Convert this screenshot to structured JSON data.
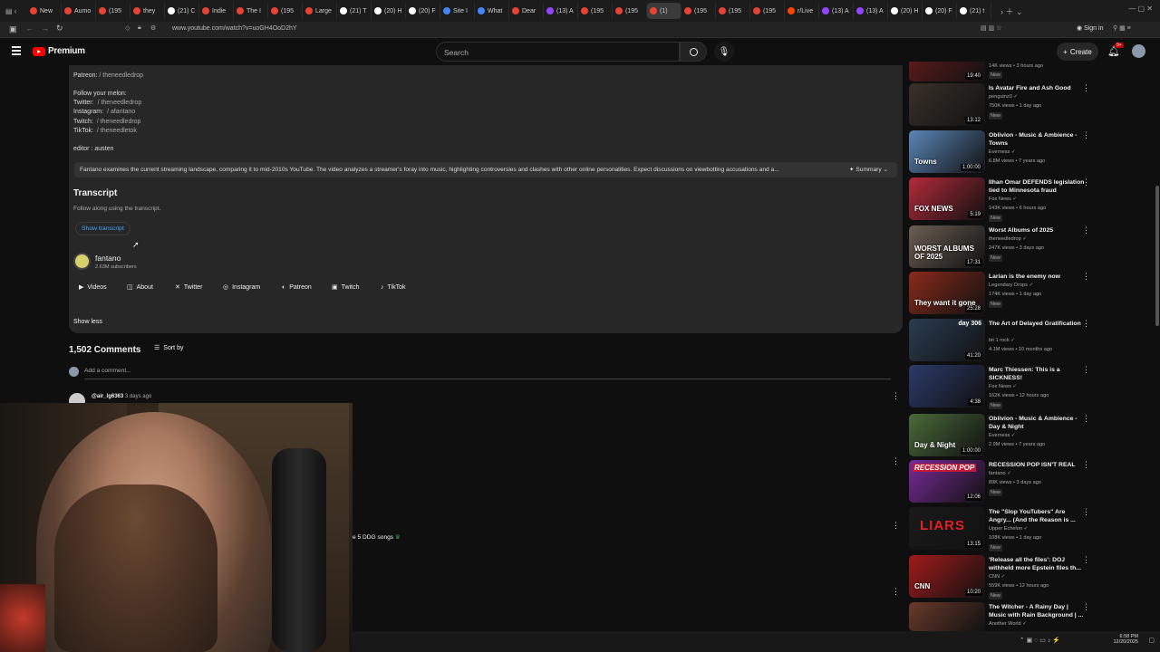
{
  "browser": {
    "tabs": [
      {
        "label": "New",
        "color": "#e94235"
      },
      {
        "label": "Aumo",
        "color": "#e94235"
      },
      {
        "label": "(195",
        "color": "#e94235"
      },
      {
        "label": "they",
        "color": "#e94235"
      },
      {
        "label": "(21) C",
        "color": "#ffffff"
      },
      {
        "label": "Indie",
        "color": "#e94235"
      },
      {
        "label": "The I",
        "color": "#e94235"
      },
      {
        "label": "(195",
        "color": "#e94235"
      },
      {
        "label": "Large",
        "color": "#e94235"
      },
      {
        "label": "(21) T",
        "color": "#ffffff"
      },
      {
        "label": "(20) H",
        "color": "#ffffff"
      },
      {
        "label": "(20) F",
        "color": "#ffffff"
      },
      {
        "label": "Site I",
        "color": "#4285f4"
      },
      {
        "label": "What",
        "color": "#4285f4"
      },
      {
        "label": "Dear",
        "color": "#e94235"
      },
      {
        "label": "(13) A",
        "color": "#9146ff"
      },
      {
        "label": "(195",
        "color": "#e94235"
      },
      {
        "label": "(195",
        "color": "#e94235"
      },
      {
        "label": "(1)",
        "color": "#e94235",
        "active": true
      },
      {
        "label": "(195",
        "color": "#e94235"
      },
      {
        "label": "(195",
        "color": "#e94235"
      },
      {
        "label": "(195",
        "color": "#e94235"
      },
      {
        "label": "r/Live",
        "color": "#ff4500"
      },
      {
        "label": "(13) A",
        "color": "#9146ff"
      },
      {
        "label": "(13) A",
        "color": "#9146ff"
      },
      {
        "label": "(20) H",
        "color": "#ffffff"
      },
      {
        "label": "(20) F",
        "color": "#ffffff"
      },
      {
        "label": "(21) t",
        "color": "#ffffff"
      }
    ],
    "url": "www.youtube.com/watch?v=uoGH4OoD2hY",
    "sign_in": "Sign in"
  },
  "header": {
    "logo": "Premium",
    "search_placeholder": "Search",
    "create": "Create",
    "notif_count": "9+"
  },
  "description": {
    "patreon_label": "Patreon:",
    "patreon_link": "/ theneedledrop",
    "follow": "Follow your melon:",
    "links": [
      {
        "label": "Twitter:",
        "link": "/ theneedledrop"
      },
      {
        "label": "Instagram:",
        "link": "/ afantano"
      },
      {
        "label": "Twitch:",
        "link": "/ theneedledrop"
      },
      {
        "label": "TikTok:",
        "link": "/ theneedletok"
      }
    ],
    "editor": "editor : austen",
    "summary_text": "Fantano examines the current streaming landscape, comparing it to mid-2010s YouTube. The video analyzes a streamer's foray into music, highlighting controversies and clashes with other online personalities. Expect discussions on viewbotting accusations and a...",
    "summary_button": "Summary",
    "transcript_title": "Transcript",
    "transcript_sub": "Follow along using the transcript.",
    "show_transcript": "Show transcript",
    "channel_name": "fantano",
    "channel_subs": "2.63M subscribers",
    "socials": [
      "Videos",
      "About",
      "Twitter",
      "Instagram",
      "Patreon",
      "Twitch",
      "TikTok"
    ],
    "show_less": "Show less"
  },
  "comments": {
    "count": "1,502 Comments",
    "sort": "Sort by",
    "add": "Add a comment...",
    "first_user": "@air_lg6363",
    "first_time": "3 days ago",
    "snippet": "e 5 DDG songs"
  },
  "sidebar": {
    "videos": [
      {
        "title": "",
        "channel": "",
        "meta": "14K views • 3 hours ago",
        "duration": "19:40",
        "new": true,
        "bg": "#6a1c1c"
      },
      {
        "title": "Is Avatar Fire and Ash Good",
        "channel": "penguinz0",
        "meta": "750K views • 1 day ago",
        "duration": "13:12",
        "new": true,
        "bg": "#3a3028"
      },
      {
        "title": "Oblivion - Music & Ambience - Towns",
        "channel": "Everness",
        "meta": "6.8M views • 7 years ago",
        "duration": "1:00:00",
        "new": false,
        "bg": "#5b86b8"
      },
      {
        "title": "Ilhan Omar DEFENDS legislation tied to Minnesota fraud",
        "channel": "Fox News",
        "meta": "143K views • 6 hours ago",
        "duration": "5:19",
        "new": true,
        "bg": "#b42a3a"
      },
      {
        "title": "Worst Albums of 2025",
        "channel": "theneedledrop",
        "meta": "247K views • 3 days ago",
        "duration": "17:31",
        "new": true,
        "bg": "#6b5e52"
      },
      {
        "title": "Larian is the enemy now",
        "channel": "Legendary Drops",
        "meta": "174K views • 1 day ago",
        "duration": "25:28",
        "new": true,
        "bg": "#8a2a1a"
      },
      {
        "title": "The Art of Delayed Gratification",
        "channel": "bit 1 rock",
        "meta": "4.1M views • 10 months ago",
        "duration": "41:20",
        "new": false,
        "bg": "#2a3c52"
      },
      {
        "title": "Marc Thiessen: This is a SICKNESS!",
        "channel": "Fox News",
        "meta": "162K views • 12 hours ago",
        "duration": "4:38",
        "new": true,
        "bg": "#2c3a6a"
      },
      {
        "title": "Oblivion - Music & Ambience - Day & Night",
        "channel": "Everness",
        "meta": "2.9M views • 7 years ago",
        "duration": "1:00:00",
        "new": false,
        "bg": "#4a6a3a"
      },
      {
        "title": "RECESSION POP ISN'T REAL",
        "channel": "fantano",
        "meta": "89K views • 3 days ago",
        "duration": "12:06",
        "new": true,
        "bg": "#7a2a9a"
      },
      {
        "title": "The \"Slop YouTubers\" Are Angry... (And the Reason is ...",
        "channel": "Upper Echelon",
        "meta": "108K views • 1 day ago",
        "duration": "13:15",
        "new": true,
        "bg": "#1a1a1a"
      },
      {
        "title": "'Release all the files': DOJ withheld more Epstein files th...",
        "channel": "CNN",
        "meta": "559K views • 12 hours ago",
        "duration": "10:20",
        "new": true,
        "bg": "#a31a1a"
      },
      {
        "title": "The Witcher - A Rainy Day | Music with Rain Background | ...",
        "channel": "Another World",
        "meta": "",
        "duration": "",
        "new": false,
        "bg": "#6a3a2a"
      }
    ],
    "new_badge": "New"
  },
  "thumb_text": {
    "towns": "Towns",
    "fox": "FOX NEWS",
    "worst": "WORST ALBUMS OF 2025",
    "larian": "They want it gone",
    "day306": "day 306",
    "day_night": "Day & Night",
    "recession": "RECESSION POP",
    "liars": "LIARS",
    "cnn": "CNN"
  },
  "taskbar": {
    "time": "6:58 PM",
    "date": "12/20/2025"
  }
}
